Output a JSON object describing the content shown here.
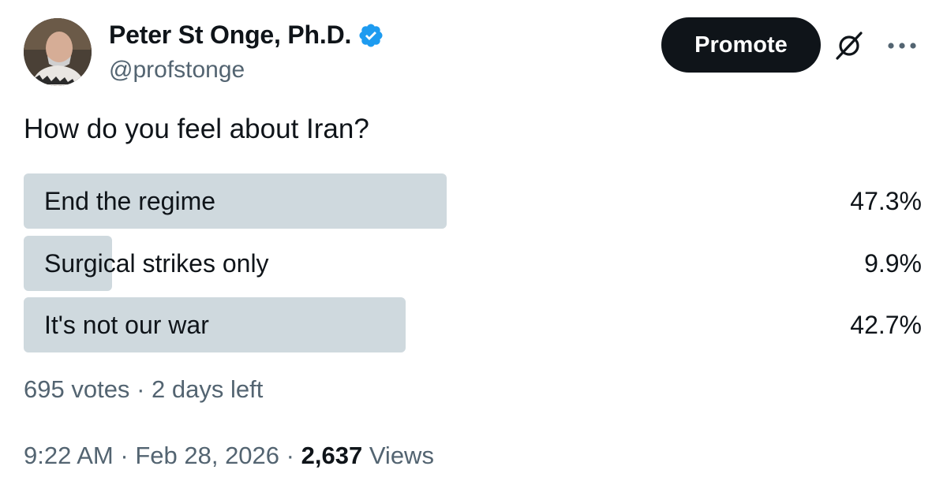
{
  "author": {
    "display_name": "Peter St Onge, Ph.D.",
    "handle": "@profstonge",
    "verified": true,
    "verified_color": "#1d9bf0"
  },
  "actions": {
    "promote_label": "Promote",
    "grok_icon": "grok-icon",
    "more_icon": "more-icon"
  },
  "poll": {
    "question": "How do you feel about Iran?",
    "options": [
      {
        "label": "End the regime",
        "percent_text": "47.3%",
        "percent": 47.3
      },
      {
        "label": "Surgical strikes only",
        "percent_text": "9.9%",
        "percent": 9.9
      },
      {
        "label": "It's not our war",
        "percent_text": "42.7%",
        "percent": 42.7
      }
    ],
    "votes": "695 votes",
    "separator": "·",
    "time_left": "2 days left",
    "bar_color": "#cfd9de"
  },
  "meta": {
    "time": "9:22 AM",
    "date": "Feb 28, 2026",
    "views_count": "2,637",
    "views_label": "Views",
    "separator": "·"
  }
}
